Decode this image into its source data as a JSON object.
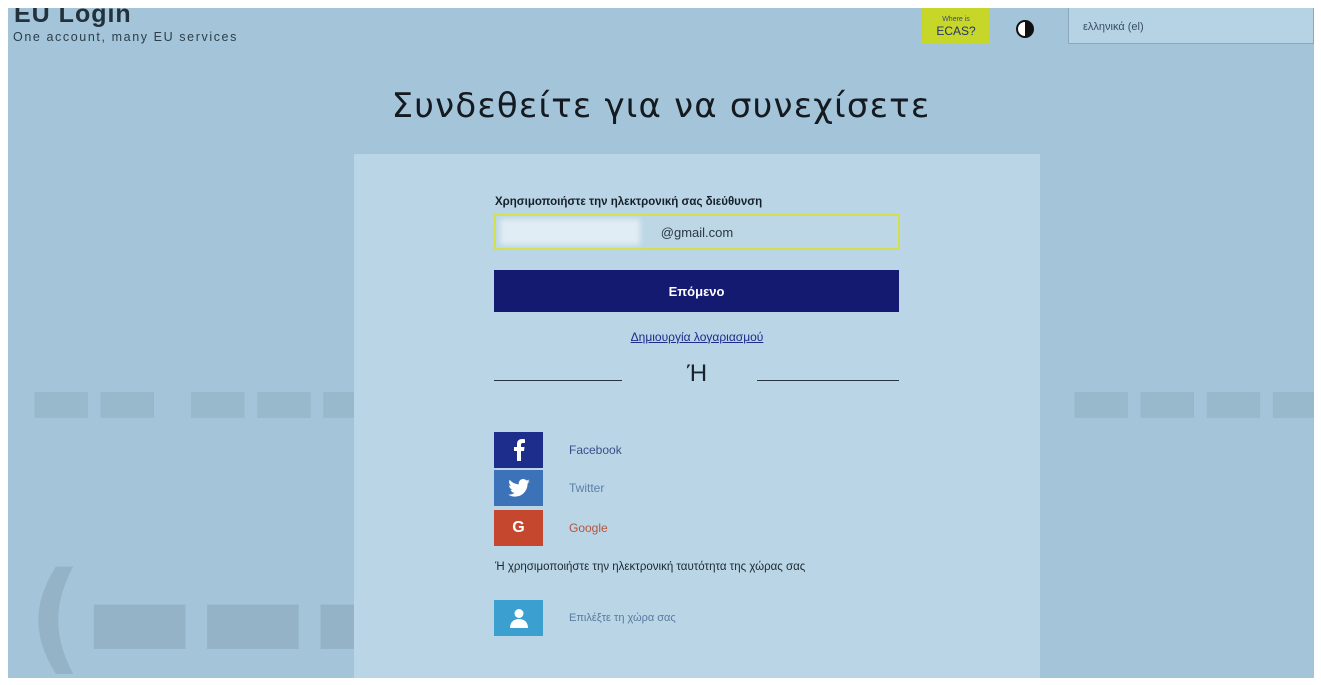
{
  "header": {
    "logo_title": "EU Login",
    "logo_subtitle": "One account, many EU services",
    "ecas_small": "Where is",
    "ecas_big": "ECAS?",
    "language": "ελληνικά (el)"
  },
  "main": {
    "heading": "Συνδεθείτε για να συνεχίσετε",
    "email_label": "Χρησιμοποιήστε την ηλεκτρονική σας διεύθυνση",
    "email_value": "@gmail.com",
    "next_label": "Επόμενο",
    "create_account": "Δημιουργία λογαριασμού",
    "or_divider": "Ή",
    "social": [
      {
        "label": "Facebook",
        "icon": "facebook-icon",
        "color": "#1c2d8c"
      },
      {
        "label": "Twitter",
        "icon": "twitter-icon",
        "color": "#3b72b8"
      },
      {
        "label": "Google",
        "icon": "google-icon",
        "color": "#c4472e"
      }
    ],
    "alt_text": "Ή χρησιμοποιήστε την ηλεκτρονική ταυτότητα της χώρας σας",
    "choose_country": "Επιλέξτε τη χώρα σας"
  },
  "colors": {
    "page_bg": "#a3c4d9",
    "primary_button": "#131a70",
    "ecas_button": "#c7d72a",
    "link": "#1c2c8a"
  }
}
